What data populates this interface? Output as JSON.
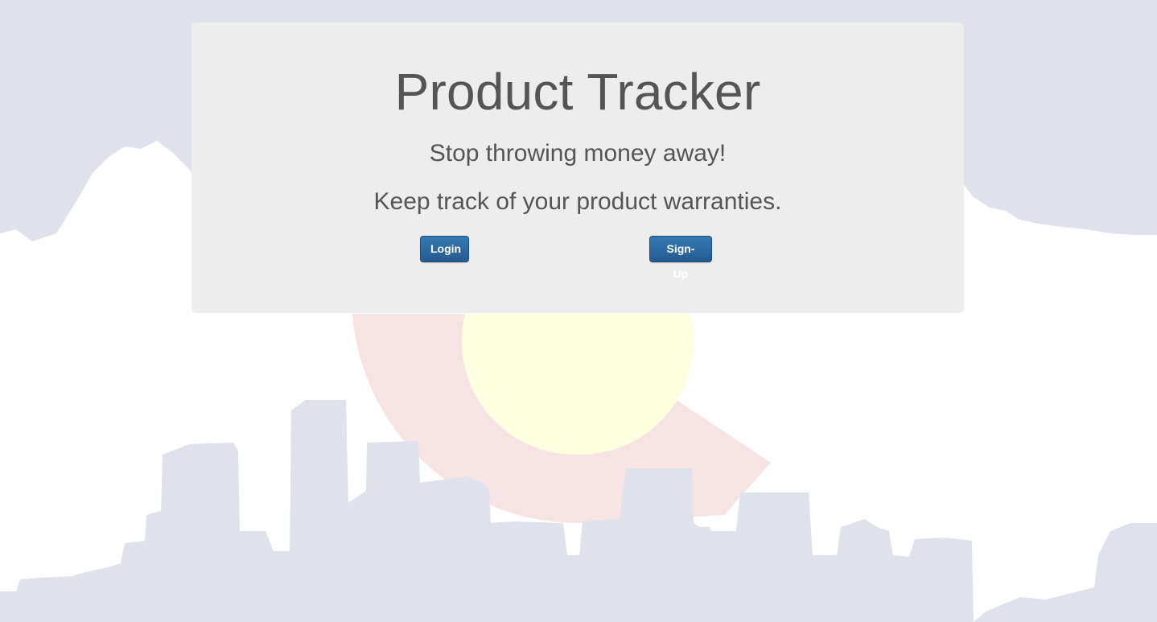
{
  "background": {
    "description_colors": {
      "sky": "#dfe2ea",
      "mountains": "#ffffff",
      "skyline": "#dfe2ea",
      "c_ring": "#f6e3e3",
      "sun": "#fdfde0"
    }
  },
  "hero": {
    "title": "Product Tracker",
    "tagline_1": "Stop throwing money away!",
    "tagline_2": "Keep track of your product warranties.",
    "login_label": "Login",
    "signup_label": "Sign-Up",
    "button_color": "#2b6aa3"
  }
}
